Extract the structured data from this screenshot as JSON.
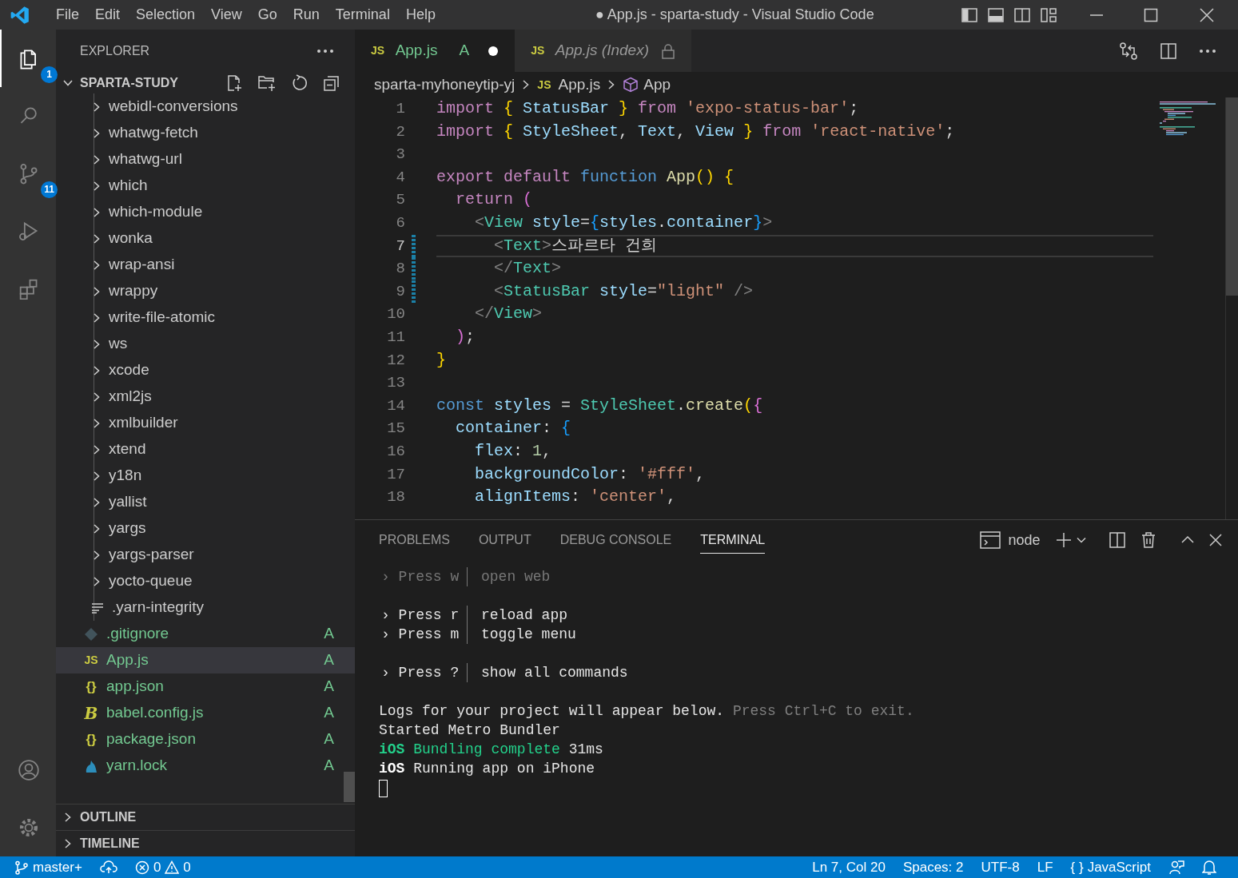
{
  "window": {
    "title": "● App.js - sparta-study - Visual Studio Code"
  },
  "menu": [
    "File",
    "Edit",
    "Selection",
    "View",
    "Go",
    "Run",
    "Terminal",
    "Help"
  ],
  "activity_bar": {
    "top": [
      {
        "kind": "explorer",
        "selected": true,
        "badge": "1"
      },
      {
        "kind": "search",
        "selected": false
      },
      {
        "kind": "source-control",
        "selected": false,
        "badge": "11"
      },
      {
        "kind": "run-debug",
        "selected": false
      },
      {
        "kind": "extensions",
        "selected": false
      }
    ],
    "bottom": [
      {
        "kind": "account",
        "selected": false
      },
      {
        "kind": "settings",
        "selected": false
      }
    ]
  },
  "sidebar": {
    "title": "EXPLORER",
    "root": {
      "label": "SPARTA-STUDY",
      "expanded": true
    },
    "tree": [
      {
        "children": [
          {
            "label": "webidl-conversions",
            "kind": "folder",
            "selected": false
          },
          {
            "label": "whatwg-fetch",
            "kind": "folder",
            "selected": false
          },
          {
            "label": "whatwg-url",
            "kind": "folder",
            "selected": false
          },
          {
            "label": "which",
            "kind": "folder",
            "selected": false
          },
          {
            "label": "which-module",
            "kind": "folder",
            "selected": false
          },
          {
            "label": "wonka",
            "kind": "folder",
            "selected": false
          },
          {
            "label": "wrap-ansi",
            "kind": "folder",
            "selected": false
          },
          {
            "label": "wrappy",
            "kind": "folder",
            "selected": false
          },
          {
            "label": "write-file-atomic",
            "kind": "folder",
            "selected": false
          },
          {
            "label": "ws",
            "kind": "folder",
            "selected": false
          },
          {
            "label": "xcode",
            "kind": "folder",
            "selected": false
          },
          {
            "label": "xml2js",
            "kind": "folder",
            "selected": false
          },
          {
            "label": "xmlbuilder",
            "kind": "folder",
            "selected": false
          },
          {
            "label": "xtend",
            "kind": "folder",
            "selected": false
          },
          {
            "label": "y18n",
            "kind": "folder",
            "selected": false
          },
          {
            "label": "yallist",
            "kind": "folder",
            "selected": false
          },
          {
            "label": "yargs",
            "kind": "folder",
            "selected": false
          },
          {
            "label": "yargs-parser",
            "kind": "folder",
            "selected": false
          },
          {
            "label": "yocto-queue",
            "kind": "folder",
            "selected": false
          },
          {
            "label": ".yarn-integrity",
            "kind": "text",
            "selected": false
          }
        ]
      },
      {
        "label": ".gitignore",
        "kind": "git",
        "status": "A",
        "selected": false
      },
      {
        "label": "App.js",
        "kind": "js",
        "icon": "JS",
        "status": "A",
        "selected": true
      },
      {
        "label": "app.json",
        "kind": "json",
        "icon": "{}",
        "status": "A",
        "selected": false
      },
      {
        "label": "babel.config.js",
        "kind": "babel",
        "icon": "B",
        "status": "A",
        "selected": false
      },
      {
        "label": "package.json",
        "kind": "json",
        "icon": "{}",
        "status": "A",
        "selected": false
      },
      {
        "label": "yarn.lock",
        "kind": "yarn",
        "status": "A",
        "selected": false
      }
    ],
    "sections": [
      {
        "label": "OUTLINE",
        "expanded": false
      },
      {
        "label": "TIMELINE",
        "expanded": false
      }
    ]
  },
  "tabs": [
    {
      "label": "App.js",
      "icon": "JS",
      "status": "A",
      "dirty": true,
      "readonly": false,
      "selected": true
    },
    {
      "label": "App.js (Index)",
      "icon": "JS",
      "dirty": false,
      "readonly": true,
      "selected": false
    }
  ],
  "breadcrumb": [
    {
      "label": "sparta-myhoneytip-yj",
      "kind": "folder"
    },
    {
      "label": "App.js",
      "kind": "js",
      "icon": "JS"
    },
    {
      "label": "App",
      "kind": "component"
    }
  ],
  "editor": {
    "lines": [
      {
        "number": "1",
        "selected": false,
        "modified": false,
        "tokens": [
          {
            "text": "import ",
            "kind": "keyword"
          },
          {
            "text": "{",
            "kind": "bracket1"
          },
          {
            "text": " StatusBar ",
            "kind": "variable"
          },
          {
            "text": "}",
            "kind": "bracket1"
          },
          {
            "text": " from ",
            "kind": "keyword"
          },
          {
            "text": "'expo-status-bar'",
            "kind": "string"
          },
          {
            "text": ";",
            "kind": "plain"
          }
        ]
      },
      {
        "number": "2",
        "selected": false,
        "modified": false,
        "tokens": [
          {
            "text": "import ",
            "kind": "keyword"
          },
          {
            "text": "{",
            "kind": "bracket1"
          },
          {
            "text": " StyleSheet",
            "kind": "variable"
          },
          {
            "text": ", ",
            "kind": "plain"
          },
          {
            "text": "Text",
            "kind": "variable"
          },
          {
            "text": ", ",
            "kind": "plain"
          },
          {
            "text": "View ",
            "kind": "variable"
          },
          {
            "text": "}",
            "kind": "bracket1"
          },
          {
            "text": " from ",
            "kind": "keyword"
          },
          {
            "text": "'react-native'",
            "kind": "string"
          },
          {
            "text": ";",
            "kind": "plain"
          }
        ]
      },
      {
        "number": "3",
        "selected": false,
        "modified": false
      },
      {
        "number": "4",
        "selected": false,
        "modified": false,
        "tokens": [
          {
            "text": "export default ",
            "kind": "keyword"
          },
          {
            "text": "function ",
            "kind": "storage"
          },
          {
            "text": "App",
            "kind": "function"
          },
          {
            "text": "() {",
            "kind": "bracket1"
          }
        ]
      },
      {
        "number": "5",
        "selected": false,
        "modified": false,
        "tokens": [
          {
            "text": "  return ",
            "kind": "keyword"
          },
          {
            "text": "(",
            "kind": "bracket2"
          }
        ]
      },
      {
        "number": "6",
        "selected": false,
        "modified": false,
        "tokens": [
          {
            "text": "    <",
            "kind": "tag-punct"
          },
          {
            "text": "View",
            "kind": "tag"
          },
          {
            "text": " style",
            "kind": "variable"
          },
          {
            "text": "=",
            "kind": "plain"
          },
          {
            "text": "{",
            "kind": "bracket3"
          },
          {
            "text": "styles",
            "kind": "variable"
          },
          {
            "text": ".",
            "kind": "plain"
          },
          {
            "text": "container",
            "kind": "variable"
          },
          {
            "text": "}",
            "kind": "bracket3"
          },
          {
            "text": ">",
            "kind": "tag-punct"
          }
        ]
      },
      {
        "number": "7",
        "selected": true,
        "modified": true,
        "tokens": [
          {
            "text": "      <",
            "kind": "tag-punct"
          },
          {
            "text": "Text",
            "kind": "tag"
          },
          {
            "text": ">",
            "kind": "tag-punct"
          },
          {
            "text": "스파르타 건희",
            "kind": "plain"
          }
        ]
      },
      {
        "number": "8",
        "selected": false,
        "modified": true,
        "tokens": [
          {
            "text": "      </",
            "kind": "tag-punct"
          },
          {
            "text": "Text",
            "kind": "tag"
          },
          {
            "text": ">",
            "kind": "tag-punct"
          }
        ]
      },
      {
        "number": "9",
        "selected": false,
        "modified": true,
        "tokens": [
          {
            "text": "      <",
            "kind": "tag-punct"
          },
          {
            "text": "StatusBar",
            "kind": "tag"
          },
          {
            "text": " style",
            "kind": "variable"
          },
          {
            "text": "=",
            "kind": "plain"
          },
          {
            "text": "\"light\"",
            "kind": "string"
          },
          {
            "text": " />",
            "kind": "tag-punct"
          }
        ]
      },
      {
        "number": "10",
        "selected": false,
        "modified": false,
        "tokens": [
          {
            "text": "    </",
            "kind": "tag-punct"
          },
          {
            "text": "View",
            "kind": "tag"
          },
          {
            "text": ">",
            "kind": "tag-punct"
          }
        ]
      },
      {
        "number": "11",
        "selected": false,
        "modified": false,
        "tokens": [
          {
            "text": "  )",
            "kind": "bracket2"
          },
          {
            "text": ";",
            "kind": "plain"
          }
        ]
      },
      {
        "number": "12",
        "selected": false,
        "modified": false,
        "tokens": [
          {
            "text": "}",
            "kind": "bracket1"
          }
        ]
      },
      {
        "number": "13",
        "selected": false,
        "modified": false
      },
      {
        "number": "14",
        "selected": false,
        "modified": false,
        "tokens": [
          {
            "text": "const ",
            "kind": "storage"
          },
          {
            "text": "styles",
            "kind": "variable"
          },
          {
            "text": " = ",
            "kind": "plain"
          },
          {
            "text": "StyleSheet",
            "kind": "tag"
          },
          {
            "text": ".",
            "kind": "plain"
          },
          {
            "text": "create",
            "kind": "function"
          },
          {
            "text": "(",
            "kind": "bracket1"
          },
          {
            "text": "{",
            "kind": "bracket2"
          }
        ]
      },
      {
        "number": "15",
        "selected": false,
        "modified": false,
        "tokens": [
          {
            "text": "  container",
            "kind": "variable"
          },
          {
            "text": ": ",
            "kind": "plain"
          },
          {
            "text": "{",
            "kind": "bracket3"
          }
        ]
      },
      {
        "number": "16",
        "selected": false,
        "modified": false,
        "tokens": [
          {
            "text": "    flex",
            "kind": "variable"
          },
          {
            "text": ": ",
            "kind": "plain"
          },
          {
            "text": "1",
            "kind": "number"
          },
          {
            "text": ",",
            "kind": "plain"
          }
        ]
      },
      {
        "number": "17",
        "selected": false,
        "modified": false,
        "tokens": [
          {
            "text": "    backgroundColor",
            "kind": "variable"
          },
          {
            "text": ": ",
            "kind": "plain"
          },
          {
            "text": "'#fff'",
            "kind": "string"
          },
          {
            "text": ",",
            "kind": "plain"
          }
        ]
      },
      {
        "number": "18",
        "selected": false,
        "modified": false,
        "tokens": [
          {
            "text": "    alignItems",
            "kind": "variable"
          },
          {
            "text": ": ",
            "kind": "plain"
          },
          {
            "text": "'center'",
            "kind": "string"
          },
          {
            "text": ",",
            "kind": "plain"
          }
        ]
      }
    ]
  },
  "panel": {
    "tabs": [
      {
        "label": "PROBLEMS",
        "selected": false
      },
      {
        "label": "OUTPUT",
        "selected": false
      },
      {
        "label": "DEBUG CONSOLE",
        "selected": false
      },
      {
        "label": "TERMINAL",
        "selected": true
      }
    ],
    "terminal_name": "node",
    "shortcut_groups": [
      [
        {
          "key": "› Press w",
          "action": "open web",
          "dim": true
        }
      ],
      [
        {
          "key": "› Press r",
          "action": "reload app",
          "dim": false
        },
        {
          "key": "› Press m",
          "action": "toggle menu",
          "dim": false
        }
      ],
      [
        {
          "key": "› Press ?",
          "action": "show all commands",
          "dim": false
        }
      ]
    ],
    "log": [
      [
        {
          "text": "Logs for your project will appear below. ",
          "kind": "plain"
        },
        {
          "text": "Press Ctrl+C to exit.",
          "kind": "dim"
        }
      ],
      [
        {
          "text": "Started Metro Bundler",
          "kind": "plain"
        }
      ],
      [
        {
          "text": "iOS",
          "kind": "green-bold"
        },
        {
          "text": " Bundling complete ",
          "kind": "green"
        },
        {
          "text": "31ms",
          "kind": "plain"
        }
      ],
      [
        {
          "text": "iOS",
          "kind": "bold"
        },
        {
          "text": " Running app on iPhone",
          "kind": "plain"
        }
      ]
    ]
  },
  "status_bar": {
    "branch": "master+",
    "errors": "0",
    "warnings": "0",
    "position": "Ln 7, Col 20",
    "indent": "Spaces: 2",
    "encoding": "UTF-8",
    "eol": "LF",
    "language_icon": "{ }",
    "language": "JavaScript"
  }
}
